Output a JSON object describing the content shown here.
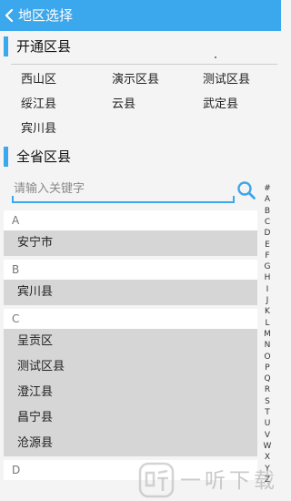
{
  "header": {
    "title": "地区选择",
    "back_icon": "chevron-left-icon"
  },
  "open_section": {
    "title": "开通区县",
    "cities": [
      "西山区",
      "演示区县",
      "测试区县",
      "绥江县",
      "云县",
      "武定县",
      "宾川县"
    ]
  },
  "all_section": {
    "title": "全省区县"
  },
  "search": {
    "placeholder": "请输入关键字",
    "value": "",
    "icon": "search-icon"
  },
  "list": [
    {
      "letter": "A",
      "items": [
        "安宁市"
      ]
    },
    {
      "letter": "B",
      "items": [
        "宾川县"
      ]
    },
    {
      "letter": "C",
      "items": [
        "呈贡区",
        "测试区县",
        "澄江县",
        "昌宁县",
        "沧源县"
      ]
    },
    {
      "letter": "D",
      "items": []
    }
  ],
  "index_letters": [
    "#",
    "A",
    "B",
    "C",
    "D",
    "E",
    "F",
    "G",
    "H",
    "I",
    "J",
    "K",
    "L",
    "M",
    "N",
    "O",
    "P",
    "Q",
    "R",
    "S",
    "T",
    "U",
    "V",
    "W",
    "X",
    "Y",
    "Z"
  ],
  "watermark": {
    "text": "一听下载",
    "logo_icon": "ting-logo-icon"
  },
  "colors": {
    "accent": "#3ba7ec",
    "item_bg": "#d6d6d6",
    "page_bg": "#f4f4f4"
  }
}
